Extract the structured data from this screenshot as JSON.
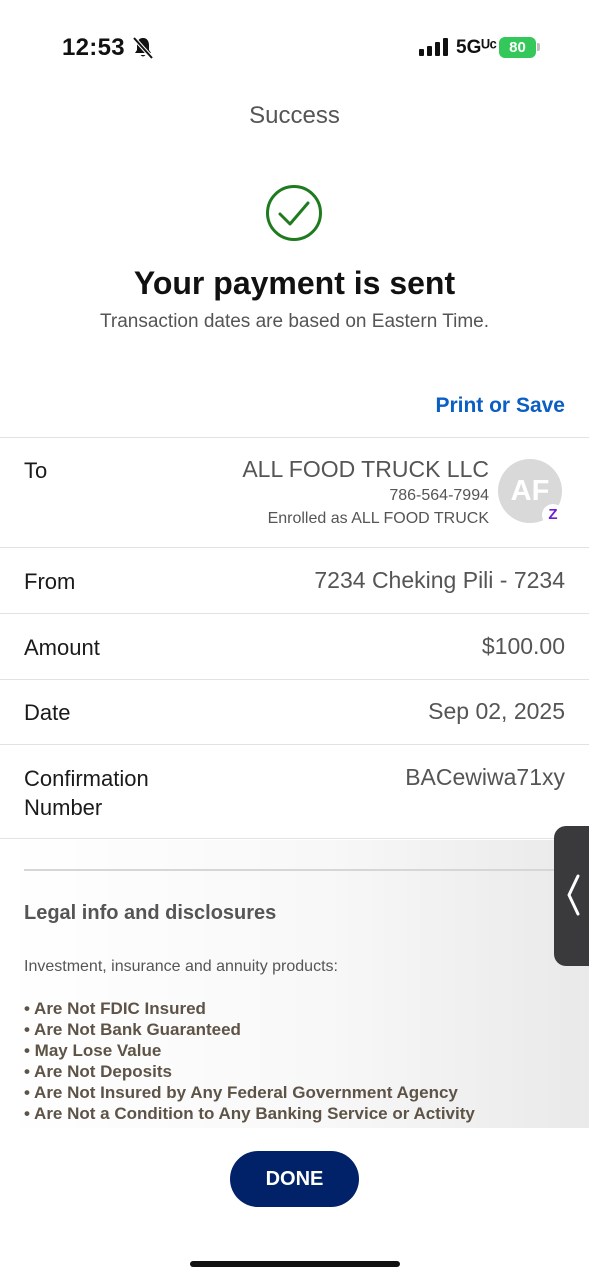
{
  "status_bar": {
    "time": "12:53",
    "network": "5Gᵁᶜ",
    "battery": "80"
  },
  "header": {
    "title": "Success"
  },
  "confirmation": {
    "headline": "Your payment is sent",
    "subline": "Transaction dates are based on Eastern Time.",
    "check_icon": "checkmark-circle-icon",
    "check_color": "#1e7b1e"
  },
  "print_save_label": "Print or Save",
  "details": {
    "to": {
      "label": "To",
      "name": "ALL FOOD TRUCK LLC",
      "phone": "786-564-7994",
      "enrolled": "Enrolled as ALL FOOD TRUCK",
      "avatar_initials": "AF",
      "badge": "Z"
    },
    "from": {
      "label": "From",
      "value": "7234 Cheking Pili - 7234"
    },
    "amount": {
      "label": "Amount",
      "value": "$100.00"
    },
    "date": {
      "label": "Date",
      "value": "Sep 02, 2025"
    },
    "confirmation_number": {
      "label_line1": "Confirmation",
      "label_line2": "Number",
      "value": "BACewiwa71xy"
    }
  },
  "legal": {
    "title": "Legal info and disclosures",
    "intro": "Investment, insurance and annuity products:",
    "items": [
      "• Are Not FDIC Insured",
      "• Are Not Bank Guaranteed",
      "• May Lose Value",
      "• Are Not Deposits",
      "• Are Not Insured by Any Federal Government Agency",
      "• Are Not a Condition to Any Banking Service or Activity"
    ]
  },
  "done_label": "DONE",
  "colors": {
    "link": "#0a5ec4",
    "primary_button": "#012169",
    "success": "#1e7b1e",
    "zelle": "#6d1ed4"
  }
}
